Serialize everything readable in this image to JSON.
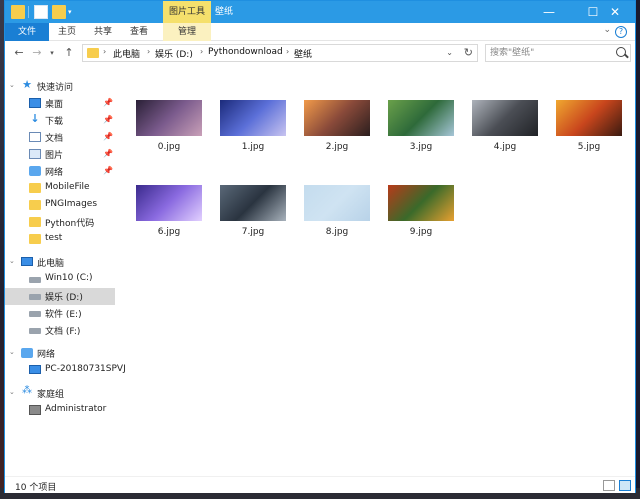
{
  "titlebar": {
    "contextual_tab": "图片工具",
    "window_title": "壁纸",
    "minimize": "—",
    "maximize": "☐",
    "close": "✕"
  },
  "ribbon": {
    "tabs": [
      "文件",
      "主页",
      "共享",
      "查看",
      "管理"
    ],
    "help": "?"
  },
  "address": {
    "crumbs": [
      "此电脑",
      "娱乐 (D:)",
      "Pythondownload",
      "壁纸"
    ],
    "search_placeholder": "搜索\"壁纸\""
  },
  "sidebar": {
    "quick_access": "快速访问",
    "quick_items": [
      {
        "label": "桌面",
        "icon": "desktop-icon",
        "pinned": true
      },
      {
        "label": "下载",
        "icon": "download-icon",
        "pinned": true
      },
      {
        "label": "文档",
        "icon": "document-icon",
        "pinned": true
      },
      {
        "label": "图片",
        "icon": "pictures-icon",
        "pinned": true
      },
      {
        "label": "网络",
        "icon": "network-icon",
        "pinned": true
      },
      {
        "label": "MobileFile",
        "icon": "folder-icon",
        "pinned": false
      },
      {
        "label": "PNGImages",
        "icon": "folder-icon",
        "pinned": false
      },
      {
        "label": "Python代码",
        "icon": "folder-icon",
        "pinned": false
      },
      {
        "label": "test",
        "icon": "folder-icon",
        "pinned": false
      }
    ],
    "this_pc": "此电脑",
    "drives": [
      {
        "label": "Win10 (C:)",
        "selected": false
      },
      {
        "label": "娱乐 (D:)",
        "selected": true
      },
      {
        "label": "软件 (E:)",
        "selected": false
      },
      {
        "label": "文档 (F:)",
        "selected": false
      }
    ],
    "network": "网络",
    "network_pc": "PC-20180731SPVJ",
    "homegroup": "家庭组",
    "user": "Administrator"
  },
  "files": [
    {
      "name": "0.jpg",
      "colors": [
        "#2a2036",
        "#7a5a8c",
        "#c9a0b8"
      ]
    },
    {
      "name": "1.jpg",
      "colors": [
        "#1b2a7a",
        "#5b6fd8",
        "#c8c4f0"
      ]
    },
    {
      "name": "2.jpg",
      "colors": [
        "#f19a4a",
        "#8a4a3a",
        "#2b1e1e"
      ]
    },
    {
      "name": "3.jpg",
      "colors": [
        "#6aa04a",
        "#2e6a3a",
        "#a6c6d8"
      ]
    },
    {
      "name": "4.jpg",
      "colors": [
        "#aeb3bb",
        "#4b4e55",
        "#202226"
      ]
    },
    {
      "name": "5.jpg",
      "colors": [
        "#f0a830",
        "#c9461d",
        "#3a1a10"
      ]
    },
    {
      "name": "6.jpg",
      "colors": [
        "#3a2a8c",
        "#8a6ae0",
        "#e2d0ff"
      ]
    },
    {
      "name": "7.jpg",
      "colors": [
        "#5a6878",
        "#2a3440",
        "#a8b2bc"
      ]
    },
    {
      "name": "8.jpg",
      "colors": [
        "#c4dcee",
        "#cfe3f2",
        "#b8d2e8"
      ]
    },
    {
      "name": "9.jpg",
      "colors": [
        "#b83a1a",
        "#3a6a2a",
        "#e8a030"
      ]
    }
  ],
  "status": {
    "count": "10 个项目"
  }
}
